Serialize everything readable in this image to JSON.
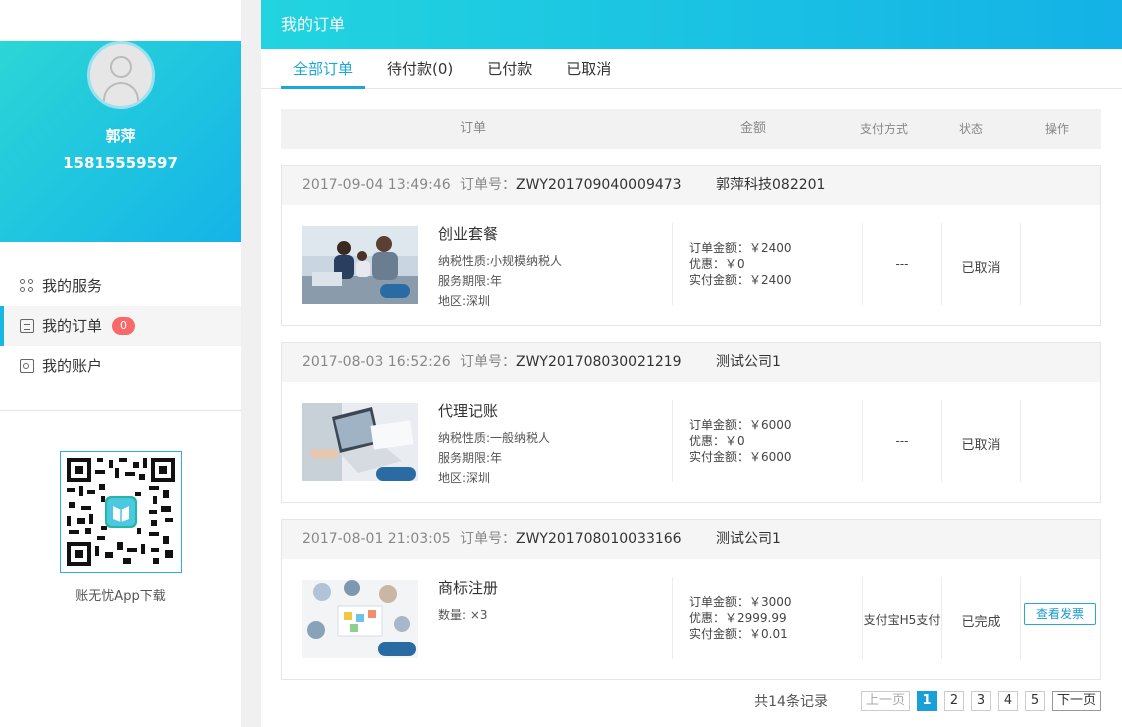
{
  "sidebar": {
    "user_name": "郭萍",
    "phone": "15815559597",
    "menu": [
      {
        "label": "我的服务",
        "icon": "services-icon"
      },
      {
        "label": "我的订单",
        "icon": "document-icon",
        "badge": "0"
      },
      {
        "label": "我的账户",
        "icon": "account-card-icon"
      }
    ],
    "qr_caption": "账无忧App下载"
  },
  "main": {
    "title": "我的订单",
    "tabs": [
      "全部订单",
      "待付款(0)",
      "已付款",
      "已取消"
    ],
    "columns": [
      "订单",
      "金额",
      "支付方式",
      "状态",
      "操作"
    ],
    "order_no_label": "订单号：",
    "orders": [
      {
        "time": "2017-09-04 13:49:46",
        "order_no": "ZWY201709040009473",
        "company": "郭萍科技082201",
        "product": "创业套餐",
        "details": [
          "纳税性质:小规模纳税人",
          "服务期限:年",
          "地区:深圳"
        ],
        "amounts": [
          "订单金额：￥2400",
          "优惠：￥0",
          "实付金额：￥2400"
        ],
        "pay_method": "---",
        "status": "已取消",
        "action": ""
      },
      {
        "time": "2017-08-03 16:52:26",
        "order_no": "ZWY201708030021219",
        "company": "测试公司1",
        "product": "代理记账",
        "details": [
          "纳税性质:一般纳税人",
          "服务期限:年",
          "地区:深圳"
        ],
        "amounts": [
          "订单金额：￥6000",
          "优惠：￥0",
          "实付金额：￥6000"
        ],
        "pay_method": "---",
        "status": "已取消",
        "action": ""
      },
      {
        "time": "2017-08-01 21:03:05",
        "order_no": "ZWY201708010033166",
        "company": "测试公司1",
        "product": "商标注册",
        "details": [
          "数量: ×3"
        ],
        "amounts": [
          "订单金额：￥3000",
          "优惠：￥2999.99",
          "实付金额：￥0.01"
        ],
        "pay_method": "支付宝H5支付",
        "status": "已完成",
        "action": "查看发票"
      }
    ],
    "pagination": {
      "total": "共14条记录",
      "prev": "上一页",
      "pages": [
        "1",
        "2",
        "3",
        "4",
        "5"
      ],
      "current": "1",
      "next": "下一页"
    }
  },
  "colors": {
    "accent": "#19a8d8",
    "header_gradient_start": "#22d4df",
    "header_gradient_end": "#14b2e6",
    "badge": "#f86a6a"
  }
}
